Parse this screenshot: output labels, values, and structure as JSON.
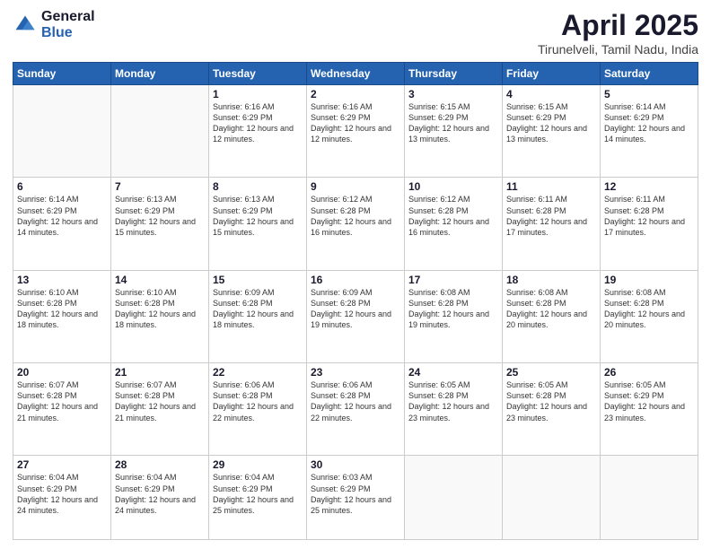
{
  "logo": {
    "general": "General",
    "blue": "Blue"
  },
  "header": {
    "title": "April 2025",
    "subtitle": "Tirunelveli, Tamil Nadu, India"
  },
  "days_of_week": [
    "Sunday",
    "Monday",
    "Tuesday",
    "Wednesday",
    "Thursday",
    "Friday",
    "Saturday"
  ],
  "weeks": [
    [
      {
        "day": "",
        "info": ""
      },
      {
        "day": "",
        "info": ""
      },
      {
        "day": "1",
        "info": "Sunrise: 6:16 AM\nSunset: 6:29 PM\nDaylight: 12 hours and 12 minutes."
      },
      {
        "day": "2",
        "info": "Sunrise: 6:16 AM\nSunset: 6:29 PM\nDaylight: 12 hours and 12 minutes."
      },
      {
        "day": "3",
        "info": "Sunrise: 6:15 AM\nSunset: 6:29 PM\nDaylight: 12 hours and 13 minutes."
      },
      {
        "day": "4",
        "info": "Sunrise: 6:15 AM\nSunset: 6:29 PM\nDaylight: 12 hours and 13 minutes."
      },
      {
        "day": "5",
        "info": "Sunrise: 6:14 AM\nSunset: 6:29 PM\nDaylight: 12 hours and 14 minutes."
      }
    ],
    [
      {
        "day": "6",
        "info": "Sunrise: 6:14 AM\nSunset: 6:29 PM\nDaylight: 12 hours and 14 minutes."
      },
      {
        "day": "7",
        "info": "Sunrise: 6:13 AM\nSunset: 6:29 PM\nDaylight: 12 hours and 15 minutes."
      },
      {
        "day": "8",
        "info": "Sunrise: 6:13 AM\nSunset: 6:29 PM\nDaylight: 12 hours and 15 minutes."
      },
      {
        "day": "9",
        "info": "Sunrise: 6:12 AM\nSunset: 6:28 PM\nDaylight: 12 hours and 16 minutes."
      },
      {
        "day": "10",
        "info": "Sunrise: 6:12 AM\nSunset: 6:28 PM\nDaylight: 12 hours and 16 minutes."
      },
      {
        "day": "11",
        "info": "Sunrise: 6:11 AM\nSunset: 6:28 PM\nDaylight: 12 hours and 17 minutes."
      },
      {
        "day": "12",
        "info": "Sunrise: 6:11 AM\nSunset: 6:28 PM\nDaylight: 12 hours and 17 minutes."
      }
    ],
    [
      {
        "day": "13",
        "info": "Sunrise: 6:10 AM\nSunset: 6:28 PM\nDaylight: 12 hours and 18 minutes."
      },
      {
        "day": "14",
        "info": "Sunrise: 6:10 AM\nSunset: 6:28 PM\nDaylight: 12 hours and 18 minutes."
      },
      {
        "day": "15",
        "info": "Sunrise: 6:09 AM\nSunset: 6:28 PM\nDaylight: 12 hours and 18 minutes."
      },
      {
        "day": "16",
        "info": "Sunrise: 6:09 AM\nSunset: 6:28 PM\nDaylight: 12 hours and 19 minutes."
      },
      {
        "day": "17",
        "info": "Sunrise: 6:08 AM\nSunset: 6:28 PM\nDaylight: 12 hours and 19 minutes."
      },
      {
        "day": "18",
        "info": "Sunrise: 6:08 AM\nSunset: 6:28 PM\nDaylight: 12 hours and 20 minutes."
      },
      {
        "day": "19",
        "info": "Sunrise: 6:08 AM\nSunset: 6:28 PM\nDaylight: 12 hours and 20 minutes."
      }
    ],
    [
      {
        "day": "20",
        "info": "Sunrise: 6:07 AM\nSunset: 6:28 PM\nDaylight: 12 hours and 21 minutes."
      },
      {
        "day": "21",
        "info": "Sunrise: 6:07 AM\nSunset: 6:28 PM\nDaylight: 12 hours and 21 minutes."
      },
      {
        "day": "22",
        "info": "Sunrise: 6:06 AM\nSunset: 6:28 PM\nDaylight: 12 hours and 22 minutes."
      },
      {
        "day": "23",
        "info": "Sunrise: 6:06 AM\nSunset: 6:28 PM\nDaylight: 12 hours and 22 minutes."
      },
      {
        "day": "24",
        "info": "Sunrise: 6:05 AM\nSunset: 6:28 PM\nDaylight: 12 hours and 23 minutes."
      },
      {
        "day": "25",
        "info": "Sunrise: 6:05 AM\nSunset: 6:28 PM\nDaylight: 12 hours and 23 minutes."
      },
      {
        "day": "26",
        "info": "Sunrise: 6:05 AM\nSunset: 6:29 PM\nDaylight: 12 hours and 23 minutes."
      }
    ],
    [
      {
        "day": "27",
        "info": "Sunrise: 6:04 AM\nSunset: 6:29 PM\nDaylight: 12 hours and 24 minutes."
      },
      {
        "day": "28",
        "info": "Sunrise: 6:04 AM\nSunset: 6:29 PM\nDaylight: 12 hours and 24 minutes."
      },
      {
        "day": "29",
        "info": "Sunrise: 6:04 AM\nSunset: 6:29 PM\nDaylight: 12 hours and 25 minutes."
      },
      {
        "day": "30",
        "info": "Sunrise: 6:03 AM\nSunset: 6:29 PM\nDaylight: 12 hours and 25 minutes."
      },
      {
        "day": "",
        "info": ""
      },
      {
        "day": "",
        "info": ""
      },
      {
        "day": "",
        "info": ""
      }
    ]
  ]
}
